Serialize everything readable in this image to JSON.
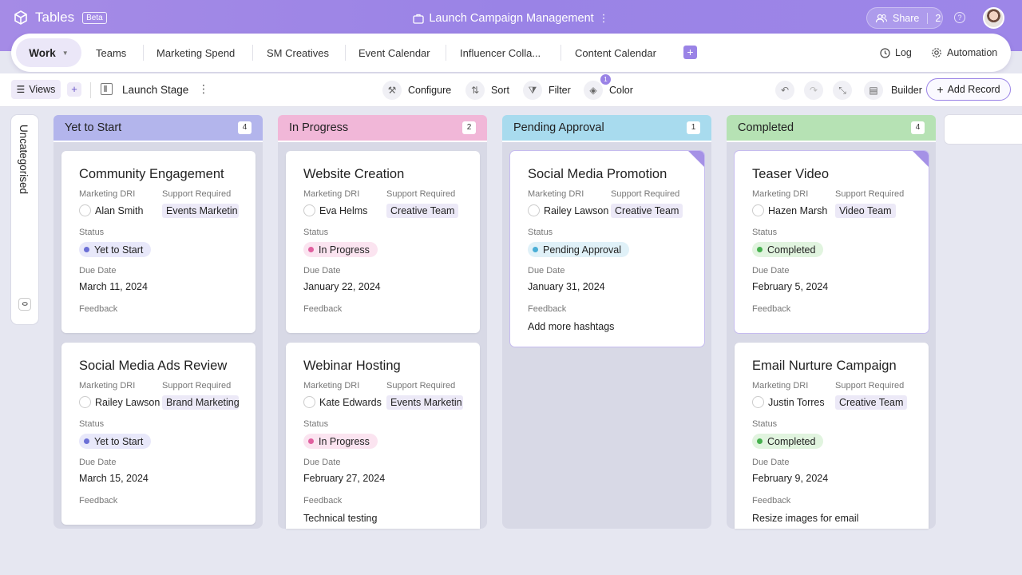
{
  "app": {
    "name": "Tables",
    "badge": "Beta"
  },
  "document": {
    "title": "Launch Campaign Management"
  },
  "share": {
    "label": "Share",
    "count": "2"
  },
  "tabs": {
    "active": "Work",
    "items": [
      "Teams",
      "Marketing Spend",
      "SM Creatives",
      "Event Calendar",
      "Influencer Colla...",
      "Content Calendar"
    ],
    "add": "+"
  },
  "right_actions": {
    "log": "Log",
    "automation": "Automation"
  },
  "toolbar": {
    "views": "Views",
    "views_add": "+",
    "stage": "Launch Stage",
    "configure": "Configure",
    "sort": "Sort",
    "filter": "Filter",
    "color": "Color",
    "color_badge": "1",
    "builder": "Builder",
    "add_record": "Add Record"
  },
  "uncategorised": {
    "label": "Uncategorised",
    "count": "0"
  },
  "field_labels": {
    "marketing_dri": "Marketing DRI",
    "support_required": "Support Required",
    "status": "Status",
    "due_date": "Due Date",
    "feedback": "Feedback"
  },
  "columns": [
    {
      "title": "Yet to Start",
      "count": "4",
      "color": "#b3b5ec",
      "cards": [
        {
          "title": "Community Engagement",
          "dri": "Alan Smith",
          "support": "Events Marketin",
          "status": "Yet to Start",
          "due": "March 11, 2024",
          "feedback": ""
        },
        {
          "title": "Social Media Ads Review",
          "dri": "Railey Lawson",
          "support": "Brand Marketing",
          "status": "Yet to Start",
          "due": "March 15, 2024",
          "feedback": ""
        }
      ]
    },
    {
      "title": "In Progress",
      "count": "2",
      "color": "#f1b7d8",
      "cards": [
        {
          "title": "Website Creation",
          "dri": "Eva Helms",
          "support": "Creative Team",
          "status": "In Progress",
          "due": "January 22, 2024",
          "feedback": ""
        },
        {
          "title": "Webinar Hosting",
          "dri": "Kate Edwards",
          "support": "Events Marketin",
          "status": "In Progress",
          "due": "February 27, 2024",
          "feedback": "Technical testing"
        }
      ]
    },
    {
      "title": "Pending Approval",
      "count": "1",
      "color": "#a8dbee",
      "cards": [
        {
          "title": "Social Media Promotion",
          "dri": "Railey Lawson",
          "support": "Creative Team",
          "status": "Pending Approval",
          "due": "January 31, 2024",
          "feedback": "Add more hashtags"
        }
      ]
    },
    {
      "title": "Completed",
      "count": "4",
      "color": "#b6e2b4",
      "cards": [
        {
          "title": "Teaser Video",
          "dri": "Hazen Marsh",
          "support": "Video Team",
          "status": "Completed",
          "due": "February 5, 2024",
          "feedback": ""
        },
        {
          "title": "Email Nurture Campaign",
          "dri": "Justin Torres",
          "support": "Creative Team",
          "status": "Completed",
          "due": "February 9, 2024",
          "feedback": "Resize images for email"
        }
      ]
    }
  ],
  "status_colors": {
    "yet_to_start": {
      "dot": "#6b6fd6",
      "bg": "#e8e8fa"
    },
    "in_progress": {
      "dot": "#e0609f",
      "bg": "#fbe4f0"
    },
    "pending_approval": {
      "dot": "#4aaed6",
      "bg": "#e0f1f8"
    },
    "completed": {
      "dot": "#46b04e",
      "bg": "#e1f4df"
    }
  },
  "accent_color": "#9a83e6"
}
